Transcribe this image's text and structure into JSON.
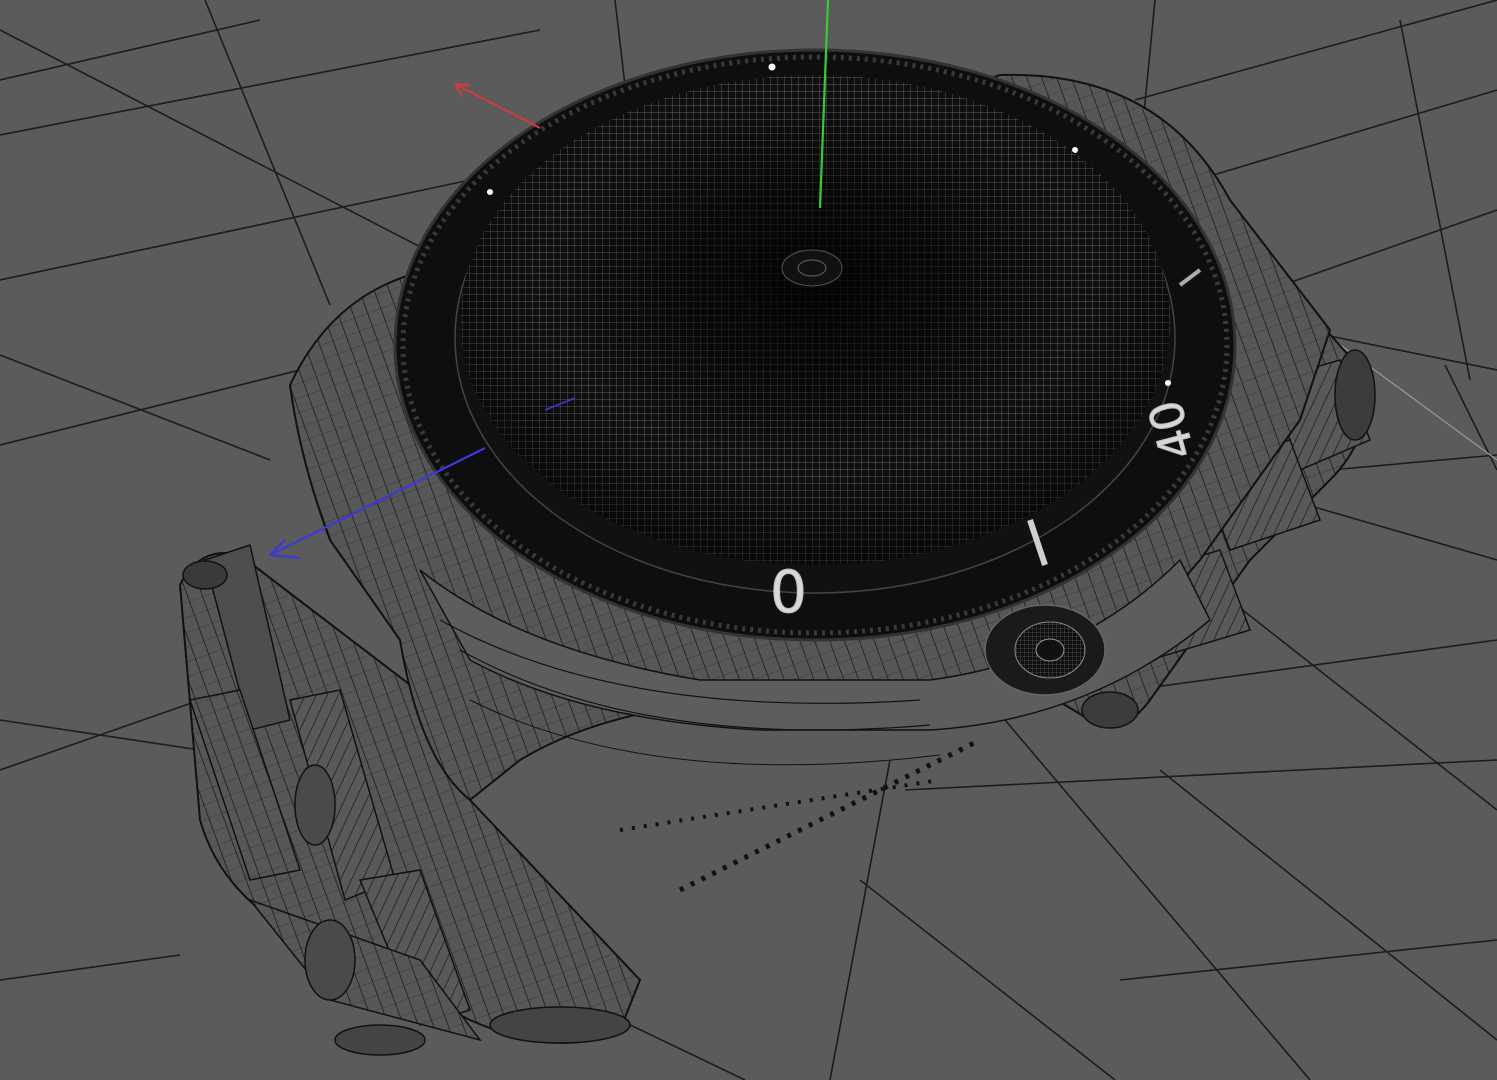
{
  "viewport": {
    "background": "#5b5b5b",
    "grid_color": "#1f1f1f",
    "grid_light_color": "#8a8a8a",
    "axes": {
      "x_color": "#d43a3a",
      "y_color": "#2fd12f",
      "z_color": "#3a3ad8"
    }
  },
  "model": {
    "description_icon": "wristwatch-wireframe-icon",
    "bezel_numbers": {
      "zero": "0",
      "forty": "40"
    },
    "wire_color": "#111111",
    "mesh_line_color": "#9a9a9a"
  }
}
